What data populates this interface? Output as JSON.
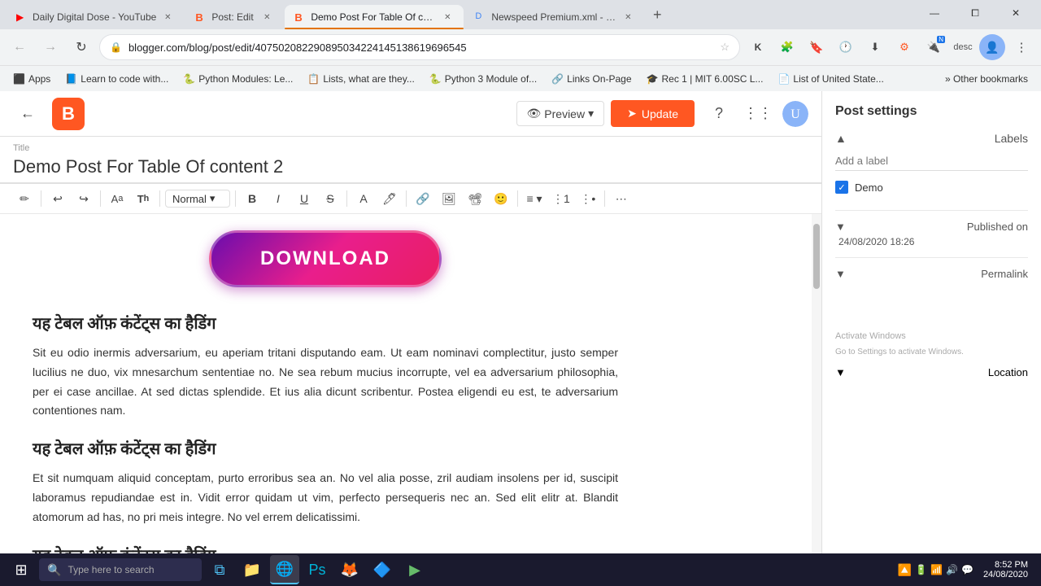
{
  "browser": {
    "tabs": [
      {
        "id": "tab-youtube",
        "title": "Daily Digital Dose - YouTube",
        "favicon": "▶",
        "favicon_color": "#ff0000",
        "active": false
      },
      {
        "id": "tab-post-edit",
        "title": "Post: Edit",
        "favicon": "B",
        "favicon_color": "#ff5722",
        "active": false
      },
      {
        "id": "tab-demo-post",
        "title": "Demo Post For Table Of content",
        "favicon": "B",
        "favicon_color": "#ff5722",
        "active": true
      },
      {
        "id": "tab-newspeed",
        "title": "Newspeed Premium.xml - Goog...",
        "favicon": "D",
        "favicon_color": "#4285f4",
        "active": false
      }
    ],
    "address": "blogger.com/blog/post/edit/4075020822908950342241451386196965 45",
    "full_address": "blogger.com/blog/post/edit/407502082290895034224145138619696545"
  },
  "bookmarks": [
    {
      "id": "apps",
      "label": "Apps",
      "icon": "🔶"
    },
    {
      "id": "learn-to-code",
      "label": "Learn to code with...",
      "icon": "📘"
    },
    {
      "id": "python-modules",
      "label": "Python Modules: Le...",
      "icon": "🐍"
    },
    {
      "id": "lists",
      "label": "Lists, what are they...",
      "icon": "📋"
    },
    {
      "id": "python-3-module",
      "label": "Python 3 Module of...",
      "icon": "🐍"
    },
    {
      "id": "links-on-page",
      "label": "Links On-Page",
      "icon": "🔗"
    },
    {
      "id": "rec1-mit",
      "label": "Rec 1 | MIT 6.00SC L...",
      "icon": "🎓"
    },
    {
      "id": "list-united-states",
      "label": "List of United State...",
      "icon": "📄"
    }
  ],
  "editor": {
    "title_label": "Title",
    "title_value": "Demo Post For Table Of content 2",
    "toolbar": {
      "format_dropdown": "Normal",
      "buttons": [
        "pencil",
        "undo",
        "redo",
        "font-size",
        "format",
        "bold",
        "italic",
        "underline",
        "strikethrough",
        "font-color",
        "highlight",
        "link",
        "image",
        "video",
        "emoji",
        "align",
        "list-ol",
        "list-ul",
        "more"
      ],
      "preview_label": "Preview",
      "update_label": "Update"
    },
    "content": {
      "download_btn_text": "DOWNLOAD",
      "headings": [
        "यह टेबल ऑफ़ कंटेंट्स का हैडिंग",
        "यह टेबल ऑफ़ कंटेंट्स का हैडिंग",
        "यह टेबल ऑफ़ कंटेंट्स का हैडिंग"
      ],
      "paragraphs": [
        "Sit eu odio inermis adversarium, eu aperiam tritani disputando eam. Ut eam nominavi complectitur, justo semper lucilius ne duo, vix mnesarchum sententiae no. Ne sea rebum mucius incorrupte, vel ea adversarium philosophia, per ei case ancillae. At sed dictas splendide. Et ius alia dicunt scribentur. Postea eligendi eu est, te adversarium contentiones nam.",
        "Et sit numquam aliquid conceptam, purto erroribus sea an. No vel alia posse, zril audiam insolens per id, suscipit laboramus repudiandae est in. Vidit error quidam ut vim, perfecto persequeris nec an. Sed elit elitr at. Blandit atomorum ad has, no pri meis integre. No vel errem delicatissimi."
      ]
    }
  },
  "sidebar": {
    "title": "Post settings",
    "labels_section": {
      "title": "Labels",
      "add_label_placeholder": "Add a label",
      "items": [
        {
          "label": "Demo",
          "checked": true
        }
      ]
    },
    "published_section": {
      "title": "Published on",
      "date": "24/08/2020 18:26"
    },
    "permalink_section": {
      "title": "Permalink"
    },
    "location_section": {
      "title": "Location"
    }
  },
  "watermark": {
    "line1": "Activate Windows",
    "line2": "Go to Settings to activate Windows."
  },
  "taskbar": {
    "search_placeholder": "Type here to search",
    "time": "8:52 PM",
    "date": "24/08/2020"
  },
  "window_controls": {
    "minimize": "—",
    "maximize": "⧠",
    "close": "✕"
  }
}
